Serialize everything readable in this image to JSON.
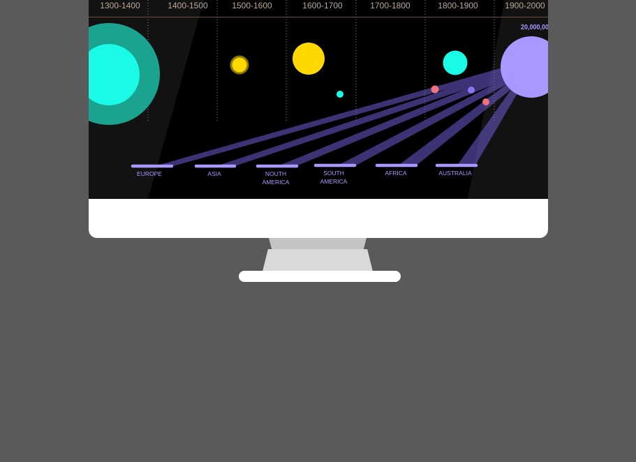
{
  "decades": [
    "1300-1400",
    "1400-1500",
    "1500-1600",
    "1600-1700",
    "1700-1800",
    "1800-1900",
    "1900-2000"
  ],
  "regions": [
    {
      "label_lines": [
        "EUROPE"
      ]
    },
    {
      "label_lines": [
        "ASIA"
      ]
    },
    {
      "label_lines": [
        "NOUTH",
        "AMERICA"
      ]
    },
    {
      "label_lines": [
        "SOUTH",
        "AMERICA"
      ]
    },
    {
      "label_lines": [
        "AFRICA"
      ]
    },
    {
      "label_lines": [
        "AUSTRALIA"
      ]
    }
  ],
  "big_value": "20,000,00",
  "colors": {
    "screen_bg": "#121212",
    "panel_bg": "#000000",
    "decade_text": "#b9a99b",
    "header_line": "#6b4e3f",
    "teal": "#19fbe6",
    "teal_halo": "#1aa38f",
    "yellow": "#ffd800",
    "purple": "#a898ff",
    "pink": "#f0717f",
    "mid_purple": "#8a74f5",
    "beam": "#6c5dd3"
  }
}
